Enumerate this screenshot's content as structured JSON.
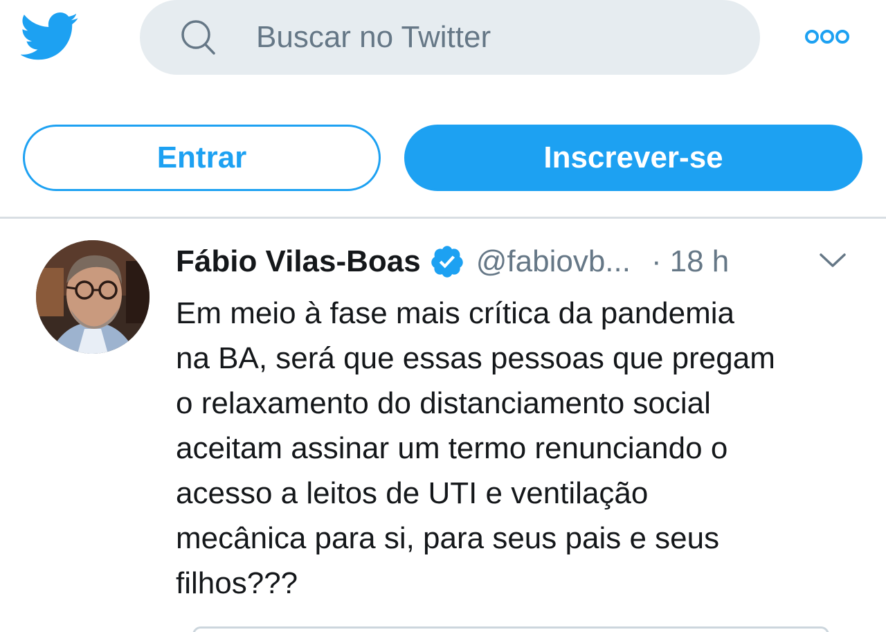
{
  "header": {
    "logo_icon": "twitter-bird-icon",
    "search": {
      "placeholder": "Buscar no Twitter",
      "icon": "search-icon"
    },
    "more_icon": "more-options-icon"
  },
  "actions": {
    "login_label": "Entrar",
    "signup_label": "Inscrever-se"
  },
  "tweet": {
    "author_name": "Fábio Vilas-Boas",
    "verified": true,
    "handle": "@fabiovb...",
    "separator": "·",
    "time": "18 h",
    "lines": [
      "Em meio à fase mais crítica da pandemia",
      "na BA, será que essas pessoas que pregam",
      "o relaxamento do distanciamento social",
      "aceitam assinar um termo renunciando o",
      "acesso a leitos de UTI e ventilação",
      "mecânica para si, para seus pais e seus",
      "filhos???"
    ]
  },
  "colors": {
    "brand": "#1da1f2",
    "search_bg": "#e6ecf0",
    "text_primary": "#14171a",
    "text_secondary": "#657786"
  }
}
